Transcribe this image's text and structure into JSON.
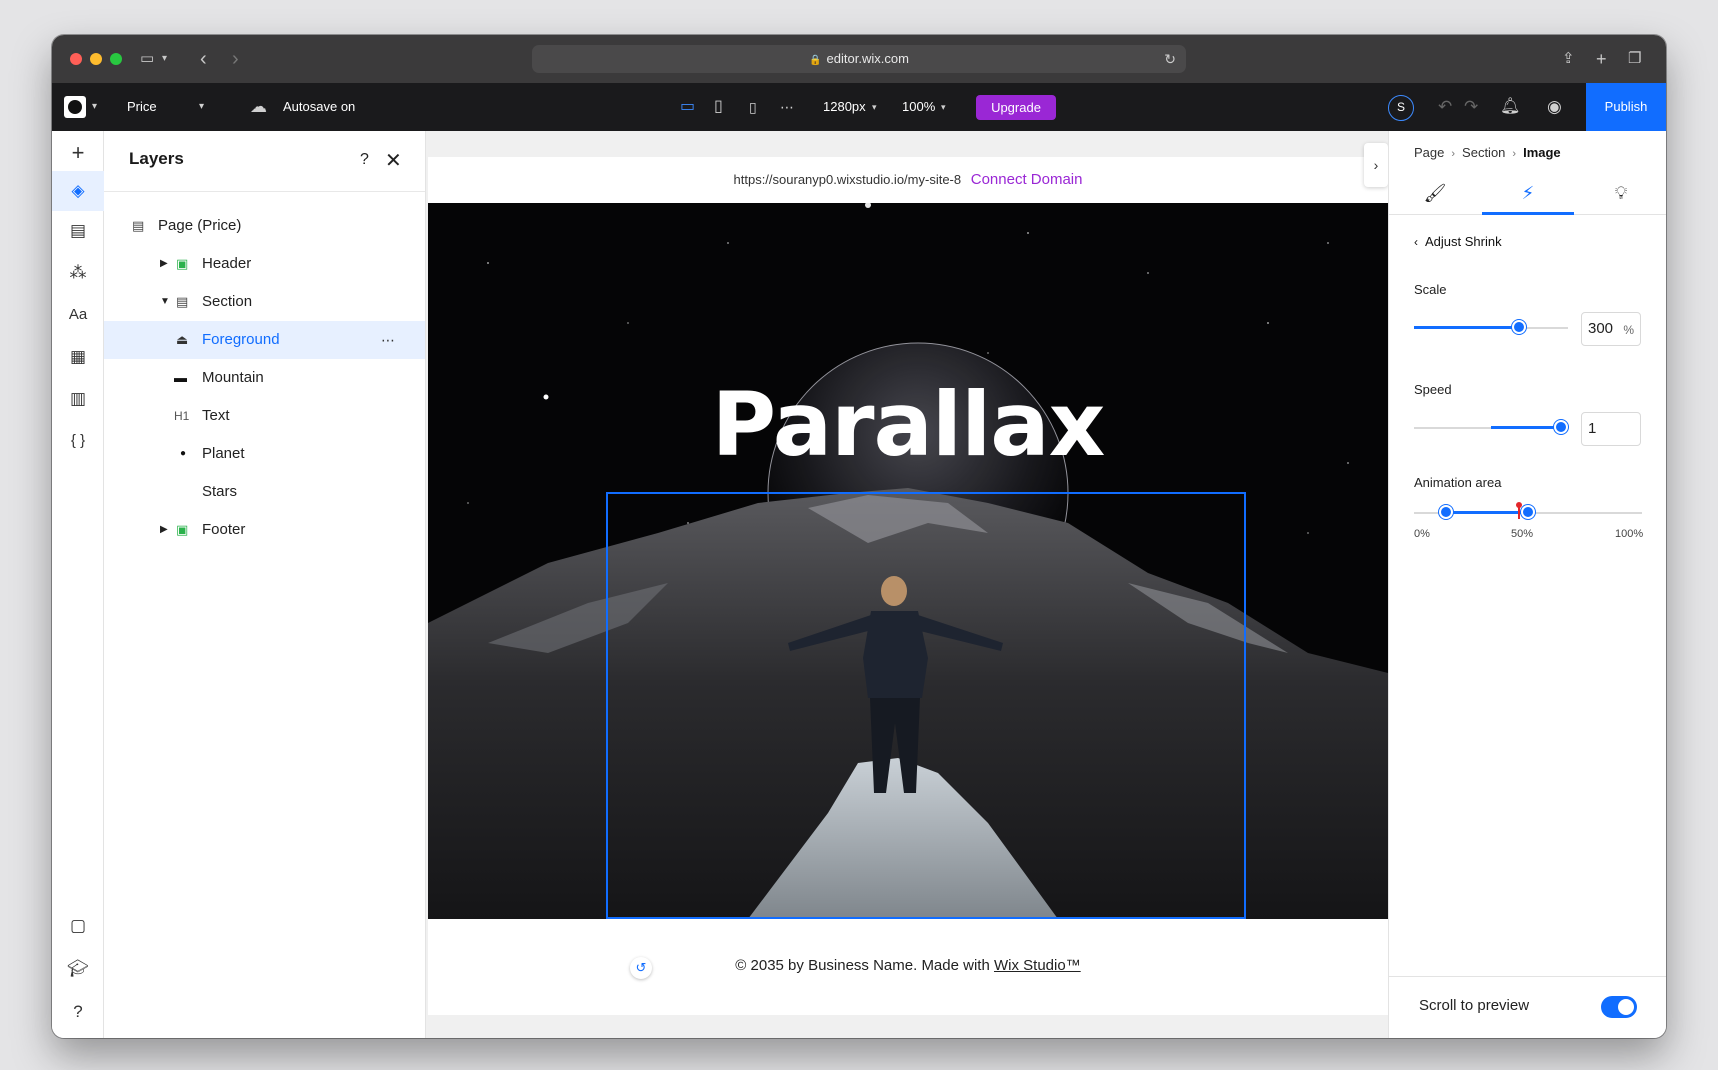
{
  "browser": {
    "url": "editor.wix.com"
  },
  "topbar": {
    "page_name": "Price",
    "autosave": "Autosave on",
    "breakpoint": "1280px",
    "zoom": "100%",
    "upgrade_label": "Upgrade",
    "avatar_letter": "S",
    "publish_label": "Publish"
  },
  "layers": {
    "title": "Layers",
    "help": "?",
    "items": [
      {
        "label": "Page (Price)",
        "icon": "page-icon"
      },
      {
        "label": "Header",
        "icon": "section-icon"
      },
      {
        "label": "Section",
        "icon": "section-icon"
      },
      {
        "label": "Foreground",
        "icon": "image-icon",
        "selected": true
      },
      {
        "label": "Mountain",
        "icon": "image-icon"
      },
      {
        "label": "Text",
        "icon": "heading-icon",
        "prefix": "H1"
      },
      {
        "label": "Planet",
        "icon": "circle-icon"
      },
      {
        "label": "Stars",
        "icon": "image-icon"
      },
      {
        "label": "Footer",
        "icon": "section-icon"
      }
    ]
  },
  "canvas": {
    "site_url": "https://souranyp0.wixstudio.io/my-site-8",
    "connect_domain": "Connect Domain",
    "hero_title": "Parallax",
    "footer_text": "© 2035 by Business Name. Made with ",
    "footer_link": "Wix Studio™"
  },
  "inspector": {
    "breadcrumb": [
      "Page",
      "Section",
      "Image"
    ],
    "back_label": "Adjust Shrink",
    "scale": {
      "label": "Scale",
      "value": "300",
      "unit": "%",
      "fraction": 0.68
    },
    "speed": {
      "label": "Speed",
      "value": "1",
      "fraction": 1.0
    },
    "animation_area": {
      "label": "Animation area",
      "start_fraction": 0.14,
      "end_fraction": 0.5,
      "marker_fraction": 0.46,
      "ticks": [
        "0%",
        "50%",
        "100%"
      ]
    },
    "scroll_preview": {
      "label": "Scroll to preview",
      "on": true
    }
  },
  "colors": {
    "accent": "#116dff",
    "upgrade": "#9a27d5",
    "topbar": "#1a1a1c"
  }
}
